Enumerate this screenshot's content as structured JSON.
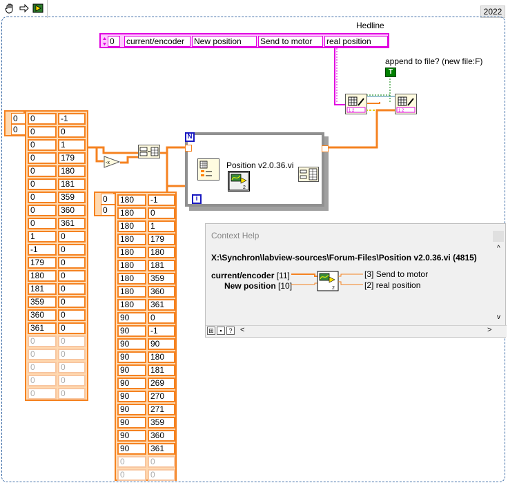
{
  "toolbar": {
    "operate_tool_icon": "hand-icon",
    "run_icon": "run-arrow-icon",
    "highlight_icon": "highlight-execution-icon",
    "version": "2022"
  },
  "cluster": {
    "label": "Hedline",
    "index": "0",
    "fields": [
      "current/encoder",
      "New position",
      "Send to motor",
      "real position"
    ]
  },
  "append_label": "append to file? (new file:F)",
  "true_constant": "T",
  "array1": {
    "index_row": "0",
    "index_col": "0",
    "rows": [
      [
        "0",
        "-1"
      ],
      [
        "0",
        "0"
      ],
      [
        "0",
        "1"
      ],
      [
        "0",
        "179"
      ],
      [
        "0",
        "180"
      ],
      [
        "0",
        "181"
      ],
      [
        "0",
        "359"
      ],
      [
        "0",
        "360"
      ],
      [
        "0",
        "361"
      ],
      [
        "1",
        "0"
      ],
      [
        "-1",
        "0"
      ],
      [
        "179",
        "0"
      ],
      [
        "180",
        "0"
      ],
      [
        "181",
        "0"
      ],
      [
        "359",
        "0"
      ],
      [
        "360",
        "0"
      ],
      [
        "361",
        "0"
      ],
      [
        "0",
        "0"
      ],
      [
        "0",
        "0"
      ],
      [
        "0",
        "0"
      ],
      [
        "0",
        "0"
      ],
      [
        "0",
        "0"
      ]
    ],
    "active_rows": 17
  },
  "array2": {
    "index_row": "0",
    "index_col": "0",
    "rows": [
      [
        "180",
        "-1"
      ],
      [
        "180",
        "0"
      ],
      [
        "180",
        "1"
      ],
      [
        "180",
        "179"
      ],
      [
        "180",
        "180"
      ],
      [
        "180",
        "181"
      ],
      [
        "180",
        "359"
      ],
      [
        "180",
        "360"
      ],
      [
        "180",
        "361"
      ],
      [
        "90",
        "0"
      ],
      [
        "90",
        "-1"
      ],
      [
        "90",
        "90"
      ],
      [
        "90",
        "180"
      ],
      [
        "90",
        "181"
      ],
      [
        "90",
        "269"
      ],
      [
        "90",
        "270"
      ],
      [
        "90",
        "271"
      ],
      [
        "90",
        "359"
      ],
      [
        "90",
        "360"
      ],
      [
        "90",
        "361"
      ],
      [
        "0",
        "0"
      ],
      [
        "0",
        "0"
      ]
    ],
    "active_rows": 20
  },
  "loop": {
    "count_terminal": "N",
    "iteration_terminal": "i",
    "subvi_name": "Position v2.0.36.vi",
    "subvi_badge": "2"
  },
  "context_help": {
    "title": "Context Help",
    "path": "X:\\Synchron\\labview-sources\\Forum-Files\\Position v2.0.36.vi (4815)",
    "inputs": [
      {
        "name": "current/encoder",
        "conn": "[11]"
      },
      {
        "name": "New position",
        "conn": "[10]"
      }
    ],
    "outputs": [
      {
        "name": "Send to motor",
        "conn": "[3]"
      },
      {
        "name": "real position",
        "conn": "[2]"
      }
    ],
    "scroll_left": "<",
    "scroll_right": ">",
    "scroll_up": "^",
    "scroll_down": "v"
  },
  "colors": {
    "array_border": "#f58220",
    "cluster_border": "#e000e0",
    "loop_border": "#909090",
    "terminal_blue": "#1818c0",
    "wire_orange": "#f58220",
    "wire_pink": "#e000e0",
    "wire_green": "#008000"
  }
}
